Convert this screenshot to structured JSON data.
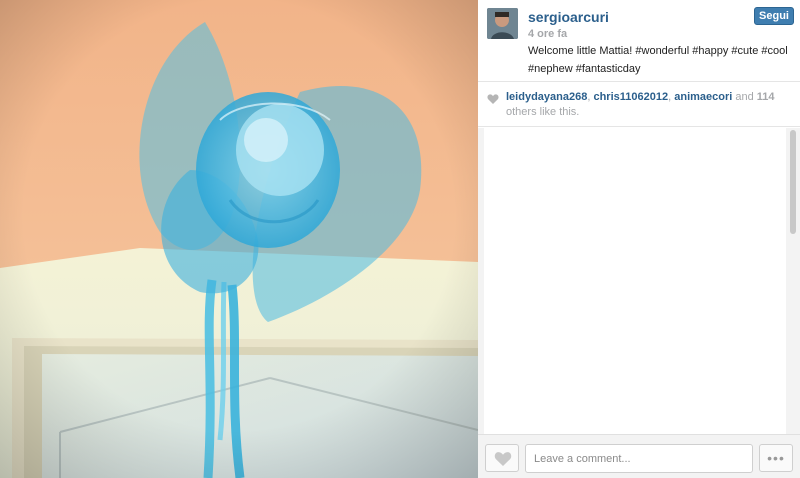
{
  "post": {
    "username": "sergioarcuri",
    "time": "4 ore fa",
    "caption": "Welcome little Mattia! #wonderful #happy #cute #cool #nephew #fantasticday",
    "follow_label": "Segui"
  },
  "likes": {
    "users": [
      "leidydayana268",
      "chris11062012",
      "animaecori"
    ],
    "sep1": ", ",
    "sep2": ", ",
    "and_text": " and ",
    "count": "114",
    "suffix": " others like this."
  },
  "comment_box": {
    "placeholder": "Leave a comment..."
  },
  "icons": {
    "like_footer": "heart-icon",
    "like_summary": "heart-icon",
    "more": "ellipsis-icon"
  },
  "colors": {
    "link": "#2b5f8c",
    "follow_button": "#3f7eb0",
    "muted_text": "#a5a7aa"
  }
}
